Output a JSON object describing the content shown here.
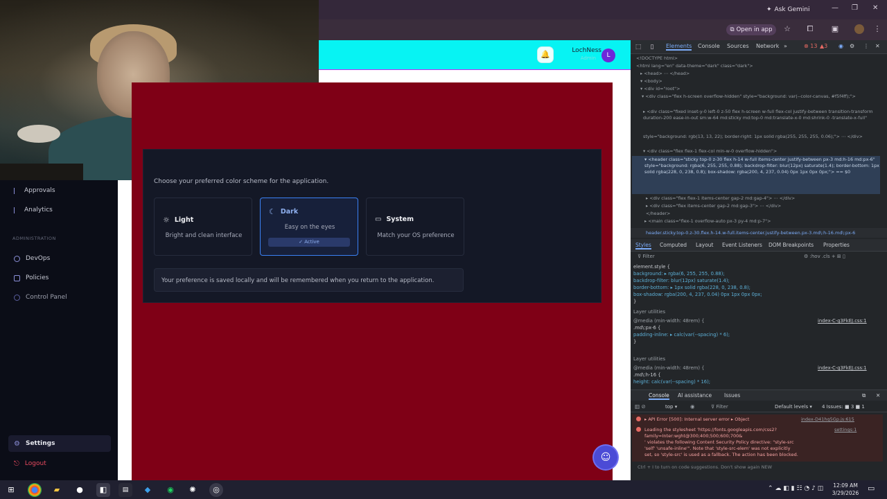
{
  "browser": {
    "ask_gemini": "Ask Gemini",
    "open_in_app": "Open in app"
  },
  "app": {
    "user_name": "LochNess",
    "user_role": "Admin",
    "avatar_letter": "L",
    "sidebar": {
      "items": [
        {
          "label": "Approvals",
          "icon": "bullet"
        },
        {
          "label": "Analytics",
          "icon": "bullet"
        }
      ],
      "section": "ADMINISTRATION",
      "admin_items": [
        {
          "label": "DevOps"
        },
        {
          "label": "Policies"
        },
        {
          "label": "Control Panel"
        }
      ],
      "settings": "Settings",
      "logout": "Logout"
    },
    "settings": {
      "description": "Choose your preferred color scheme for the application.",
      "themes": [
        {
          "title": "Light",
          "subtitle": "Bright and clean interface",
          "icon": "sun-icon"
        },
        {
          "title": "Dark",
          "subtitle": "Easy on the eyes",
          "icon": "moon-icon"
        },
        {
          "title": "System",
          "subtitle": "Match your OS preference",
          "icon": "monitor-icon"
        }
      ],
      "active_label": "✓ Active",
      "note": "Your preference is saved locally and will be remembered when you return to the application."
    }
  },
  "devtools": {
    "tabs": [
      "Elements",
      "Console",
      "Sources",
      "Network"
    ],
    "error_count": "13",
    "warning_count": "3",
    "dom_lines": [
      "<!DOCTYPE html>",
      "<html lang=\"en\" data-theme=\"dark\" class=\"dark\">",
      "▸ <head> ⋯ </head>",
      "▾ <body>",
      "  ▾ <div id=\"root\">",
      "    ▾ <div class=\"flex h-screen overflow-hidden\" style=\"background: var(--color-canvas, #f5f4ff);\">",
      "      ▸ <div class=\"fixed inset-y-0 left-0 z-50 flex h-screen w-full flex-col justify-between transition-transform duration-200 ease-in-out sm:w-64 md:sticky md:top-0 md:translate-x-0 md:shrink-0 -translate-x-full\"",
      "        style=\"background: rgb(13, 13, 22); border-right: 1px solid rgba(255, 255, 255, 0.06);\"> ⋯ </div>",
      "      ▾ <div class=\"flex flex-1 flex-col min-w-0 overflow-hidden\">",
      "        ▾ <header class=\"sticky top-0 z-30 flex h-14 w-full items-center justify-between px-3 md:h-16 md:px-6\" style=\"background: rgba(6, 255, 255, 0.88); backdrop-filter: blur(12px) saturate(1.4); border-bottom: 1px solid rgba(228, 0, 238, 0.8); box-shadow: rgba(200, 4, 237, 0.04) 0px 1px 0px 0px;\"> == $0",
      "          ▸ <div class=\"flex flex-1 items-center gap-2 md:gap-4\"> ⋯ </div>",
      "          ▸ <div class=\"flex items-center gap-2 md:gap-3\"> ⋯ </div>",
      "          </header>",
      "        ▸ <main class=\"flex-1 overflow-auto px-3 py-4 md:p-7\">"
    ],
    "breadcrumb": "header.sticky.top-0.z-30.flex.h-14.w-full.items-center.justify-between.px-3.md\\:h-16.md\\:px-6",
    "style_tabs": [
      "Styles",
      "Computed",
      "Layout",
      "Event Listeners",
      "DOM Breakpoints",
      "Properties"
    ],
    "filter_placeholder": "Filter",
    "css_lines": [
      "element.style {",
      "  background: ▸ rgba(6, 255, 255, 0.88);",
      "  backdrop-filter: blur(12px) saturate(1.4);",
      "  border-bottom: ▸ 1px solid rgba(228, 0, 238, 0.8);",
      "  box-shadow: rgba(200, 4, 237, 0.04) 0px 1px 0px 0px;",
      "}",
      "Layer utilities",
      "@media (min-width: 48rem) {",
      ".md\\:px-6 {",
      "  padding-inline: ▸ calc(var(--spacing) * 6);",
      "}",
      "Layer utilities",
      "@media (min-width: 48rem) {",
      ".md\\:h-16 {",
      "  height: calc(var(--spacing) * 16);"
    ],
    "css_source": "index-C-g3FkEJ.css:1",
    "console_tabs": [
      "Console",
      "AI assistance",
      "Issues"
    ],
    "console_context": "top ▾",
    "console_filter": "Filter",
    "default_levels": "Default levels ▾",
    "issues_count": "4 Issues: ■ 3 ■ 1",
    "errors": [
      "▸ API Error [500]: Internal server error ▸ Object",
      "Loading the stylesheet 'https://fonts.googleapis.com/css2?family=Inter:wght@300;400;500;600;700&",
      "' violates the following Content Security Policy directive: \"style-src",
      "'self' 'unsafe-inline'\". Note that 'style-src-elem' was not explicitly",
      "set, so 'style-src' is used as a fallback. The action has been blocked."
    ],
    "error_source_1": "index-D41hq5Gp.js:615",
    "error_source_2": "settings:1",
    "console_hint": "Ctrl + I to turn on code suggestions. Don't show again NEW"
  },
  "taskbar": {
    "time": "12:09 AM",
    "date": "3/29/2026"
  },
  "colors": {
    "header_bg": "#06ffff",
    "canvas_bg": "#7f0016",
    "panel_bg": "#141826",
    "active_border": "#3b82f6",
    "avatar": "#6d28d9"
  }
}
